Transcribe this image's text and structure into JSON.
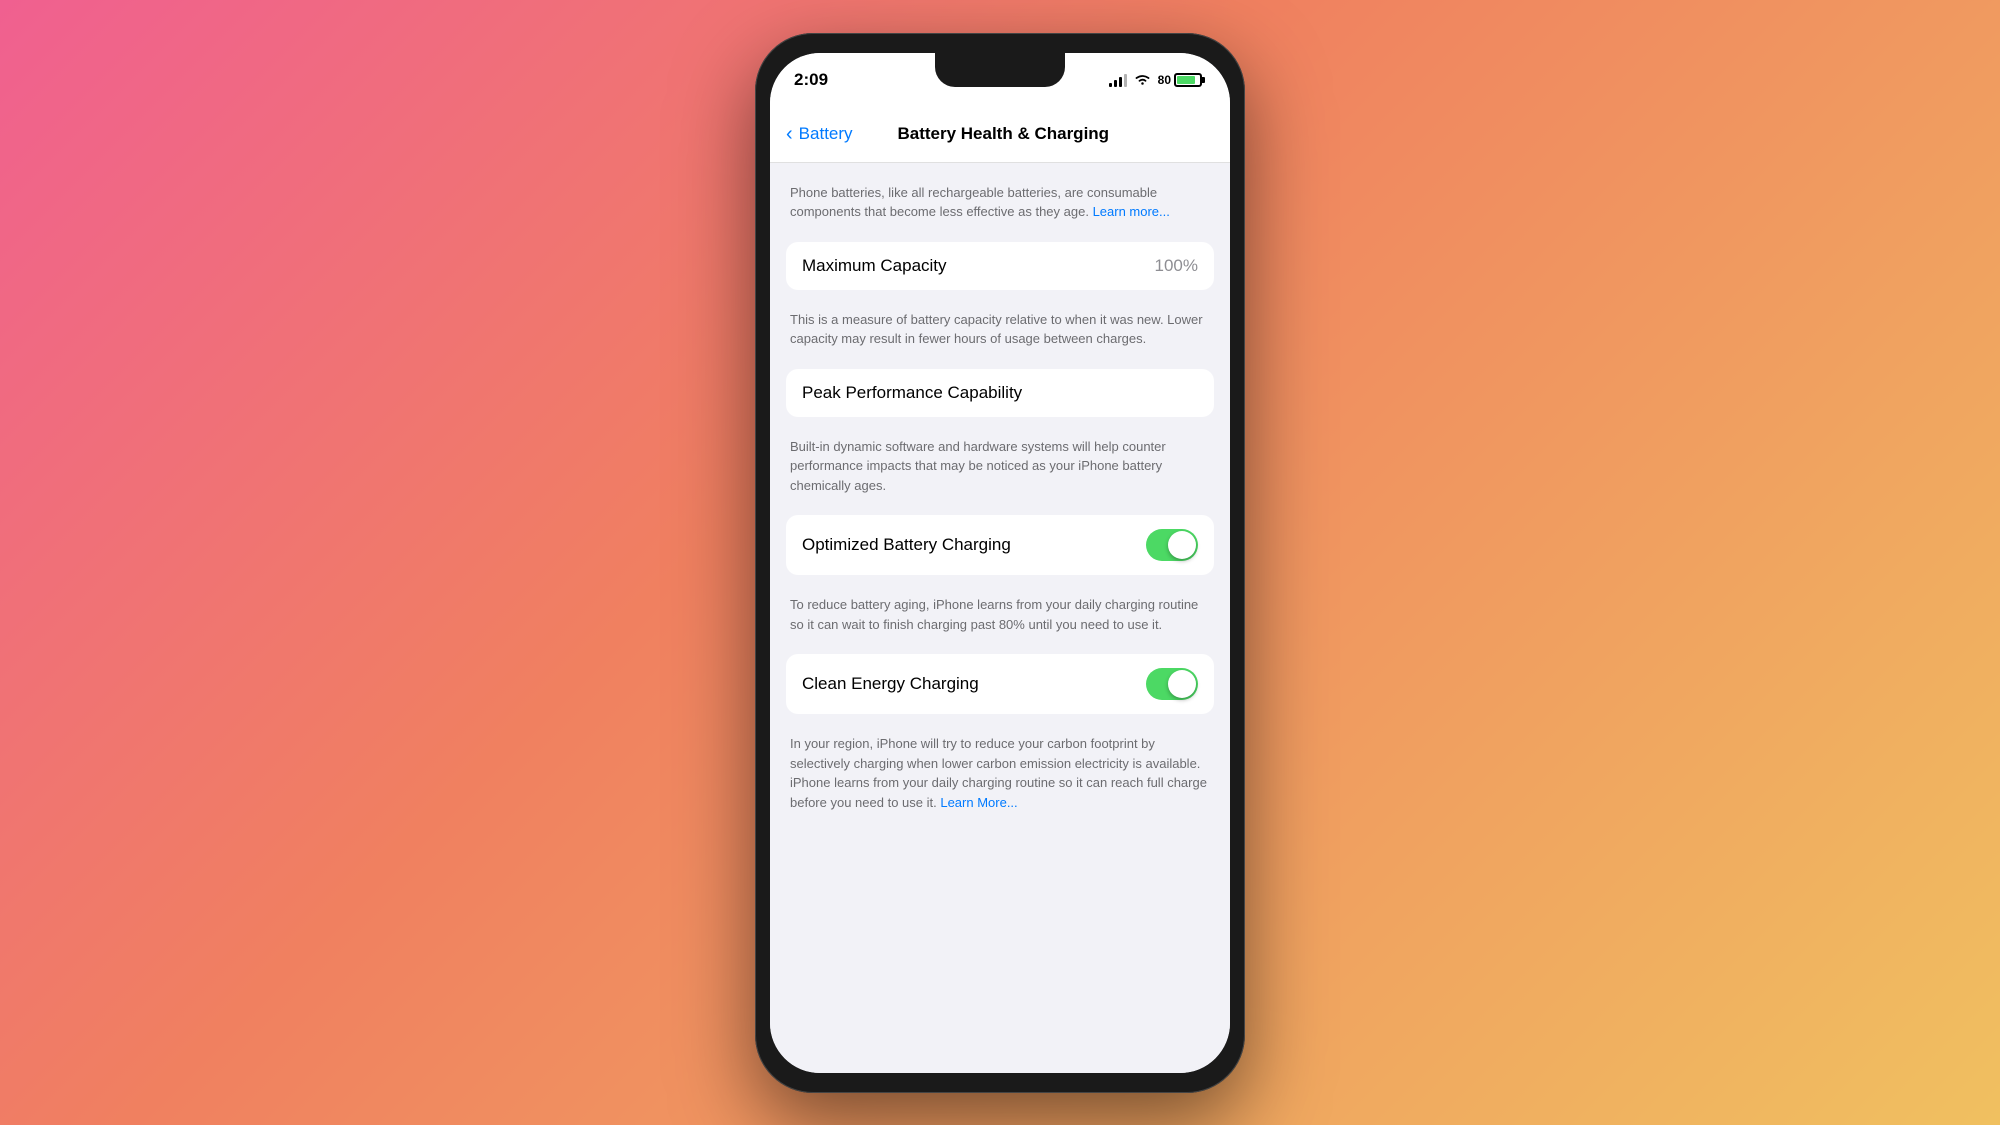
{
  "background": {
    "gradient": "135deg, #f06090 0%, #f08060 40%, #f0c060 100%"
  },
  "status_bar": {
    "time": "2:09",
    "battery_percent": "80",
    "battery_label": "80"
  },
  "nav": {
    "back_label": "Battery",
    "title": "Battery Health & Charging"
  },
  "intro": {
    "text": "Phone batteries, like all rechargeable batteries, are consumable components that become less effective as they age.",
    "learn_more": "Learn more..."
  },
  "maximum_capacity": {
    "label": "Maximum Capacity",
    "value": "100%",
    "description": "This is a measure of battery capacity relative to when it was new. Lower capacity may result in fewer hours of usage between charges."
  },
  "peak_performance": {
    "label": "Peak Performance Capability",
    "description": "Built-in dynamic software and hardware systems will help counter performance impacts that may be noticed as your iPhone battery chemically ages."
  },
  "optimized_charging": {
    "label": "Optimized Battery Charging",
    "enabled": true,
    "description": "To reduce battery aging, iPhone learns from your daily charging routine so it can wait to finish charging past 80% until you need to use it."
  },
  "clean_energy": {
    "label": "Clean Energy Charging",
    "enabled": true,
    "description": "In your region, iPhone will try to reduce your carbon footprint by selectively charging when lower carbon emission electricity is available. iPhone learns from your daily charging routine so it can reach full charge before you need to use it.",
    "learn_more": "Learn More..."
  }
}
